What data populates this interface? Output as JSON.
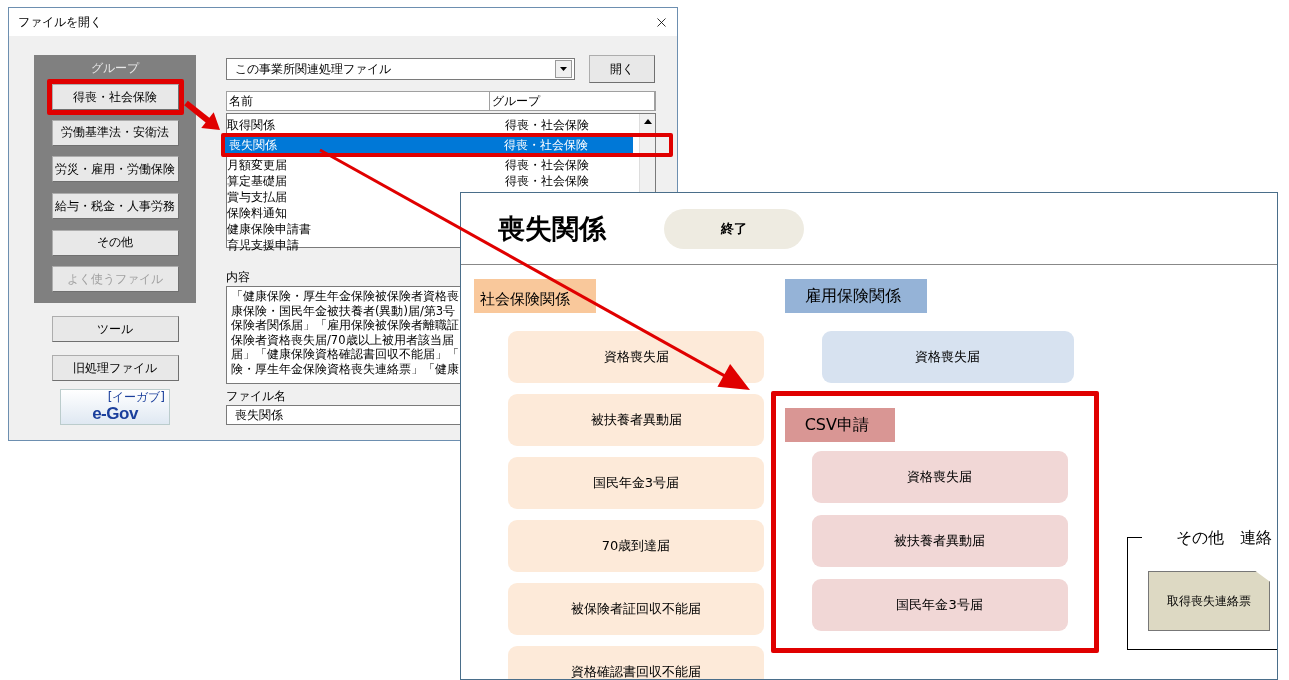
{
  "dialog": {
    "title": "ファイルを開く",
    "group_panel": {
      "title": "グループ",
      "buttons": [
        {
          "label": "得喪・社会保険",
          "highlighted": true,
          "disabled": false
        },
        {
          "label": "労働基準法・安衛法",
          "highlighted": false,
          "disabled": false
        },
        {
          "label": "労災・雇用・労働保険",
          "highlighted": false,
          "disabled": false
        },
        {
          "label": "給与・税金・人事労務",
          "highlighted": false,
          "disabled": false
        },
        {
          "label": "その他",
          "highlighted": false,
          "disabled": false
        },
        {
          "label": "よく使うファイル",
          "highlighted": false,
          "disabled": true
        }
      ]
    },
    "tool_buttons": [
      "ツール",
      "旧処理ファイル"
    ],
    "logo": {
      "text": "e-Gov",
      "reading": "[イーガブ]"
    },
    "file_type_select": {
      "value": "この事業所関連処理ファイル"
    },
    "open_button": "開く",
    "file_list": {
      "columns": [
        "名前",
        "グループ"
      ],
      "rows": [
        {
          "name": "取得関係",
          "group": "得喪・社会保険",
          "selected": false,
          "highlighted": false
        },
        {
          "name": "喪失関係",
          "group": "得喪・社会保険",
          "selected": true,
          "highlighted": true
        },
        {
          "name": "月額変更届",
          "group": "得喪・社会保険",
          "selected": false,
          "highlighted": false
        },
        {
          "name": "算定基礎届",
          "group": "得喪・社会保険",
          "selected": false,
          "highlighted": false
        },
        {
          "name": "賞与支払届",
          "selected": false,
          "highlighted": false
        },
        {
          "name": "保険料通知",
          "selected": false,
          "highlighted": false
        },
        {
          "name": "健康保険申請書",
          "selected": false,
          "highlighted": false
        },
        {
          "name": "育児支援申請",
          "selected": false,
          "highlighted": false
        }
      ]
    },
    "description": {
      "label": "内容",
      "lines": [
        "「健康保険・厚生年金保険被保険者資格喪",
        "康保険・国民年金被扶養者(異動)届/第3号",
        "保険者関係届」「雇用保険被保険者離職証",
        "保険者資格喪失届/70歳以上被用者該当届",
        "届」「健康保険資格確認書回収不能届」「",
        "険・厚生年金保険資格喪失連絡票」「健康"
      ]
    },
    "file_name": {
      "label": "ファイル名",
      "value": "喪失関係"
    }
  },
  "form_window": {
    "title": "喪失関係",
    "exit_button": "終了",
    "sections": [
      {
        "heading": "社会保険関係",
        "color": "#f9c89b",
        "buttons": [
          "資格喪失届",
          "被扶養者異動届",
          "国民年金3号届",
          "70歳到達届",
          "被保険者証回収不能届",
          "資格確認書回収不能届"
        ]
      },
      {
        "heading": "雇用保険関係",
        "color": "#95b3d7",
        "buttons": [
          "資格喪失届"
        ]
      },
      {
        "heading": "CSV申請",
        "color": "#d99694",
        "highlighted": true,
        "buttons": [
          "資格喪失届",
          "被扶養者異動届",
          "国民年金3号届"
        ]
      }
    ],
    "other_group": {
      "title": "その他　連絡",
      "buttons": [
        "取得喪失連絡票"
      ]
    }
  }
}
